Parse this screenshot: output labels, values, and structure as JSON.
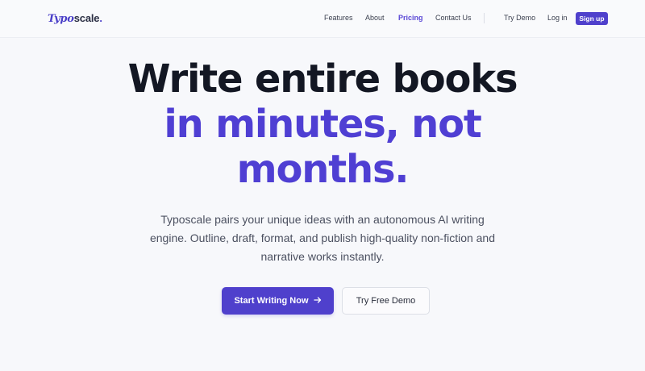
{
  "nav": {
    "logo": {
      "part1": "Typo",
      "part2": "scale",
      "dot": "."
    },
    "links": [
      {
        "label": "Features",
        "active": false
      },
      {
        "label": "About",
        "active": false
      },
      {
        "label": "Pricing",
        "active": true
      },
      {
        "label": "Contact Us",
        "active": false
      }
    ],
    "try_demo": "Try Demo",
    "login": "Log in",
    "signup": "Sign up"
  },
  "hero": {
    "headline_line1": "Write entire books",
    "headline_line2": "in minutes, not",
    "headline_line3": "months.",
    "subtitle": "Typoscale pairs your unique ideas with an autonomous AI writing engine. Outline, draft, format, and publish high-quality non-fiction and narrative works instantly.",
    "primary_cta": "Start Writing Now",
    "primary_cta_icon": "arrow-right-icon",
    "secondary_cta": "Try Free Demo"
  },
  "colors": {
    "accent": "#4f40cc",
    "headline_dark": "#131723",
    "background": "#f7f8fb"
  }
}
